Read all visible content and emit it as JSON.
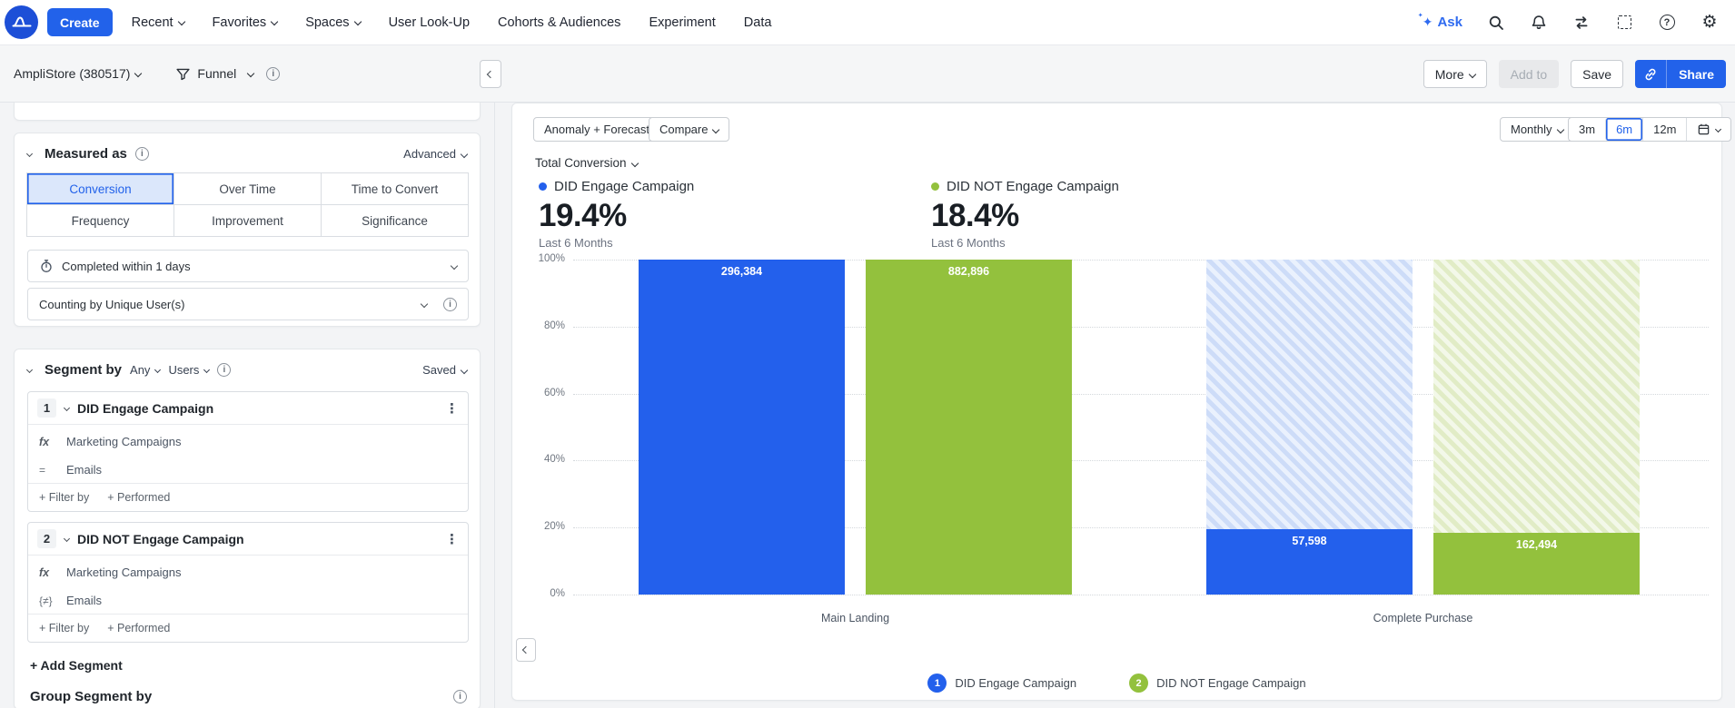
{
  "colors": {
    "accent": "#2262ea",
    "series_blue": "#2360ec",
    "series_green": "#93c13d"
  },
  "nav": {
    "create_label": "Create",
    "items": [
      {
        "label": "Recent",
        "dropdown": true
      },
      {
        "label": "Favorites",
        "dropdown": true
      },
      {
        "label": "Spaces",
        "dropdown": true
      },
      {
        "label": "User Look-Up",
        "dropdown": false
      },
      {
        "label": "Cohorts & Audiences",
        "dropdown": false
      },
      {
        "label": "Experiment",
        "dropdown": false
      },
      {
        "label": "Data",
        "dropdown": false
      }
    ],
    "ask_label": "Ask",
    "icons": [
      "sparkle-icon",
      "search-icon",
      "bell-icon",
      "swap-icon",
      "frame-icon",
      "help-icon",
      "settings-icon"
    ]
  },
  "toolbar": {
    "project": "AmpliStore (380517)",
    "chart_type": "Funnel",
    "more_label": "More",
    "add_to_label": "Add to",
    "save_label": "Save",
    "share_label": "Share"
  },
  "measured_as": {
    "title": "Measured as",
    "advanced_label": "Advanced",
    "tabs": [
      "Conversion",
      "Over Time",
      "Time to Convert",
      "Frequency",
      "Improvement",
      "Significance"
    ],
    "selected_tab": "Conversion",
    "completed_within": "Completed within 1 days",
    "counting_by": "Counting by Unique User(s)"
  },
  "segment_by": {
    "title": "Segment by",
    "any_label": "Any",
    "users_label": "Users",
    "saved_label": "Saved",
    "segments": [
      {
        "index": "1",
        "name": "DID Engage Campaign",
        "property": "Marketing Campaigns",
        "operator": "=",
        "value": "Emails",
        "filter_label": "+ Filter by",
        "performed_label": "+ Performed"
      },
      {
        "index": "2",
        "name": "DID NOT Engage Campaign",
        "property": "Marketing Campaigns",
        "operator": "{≠}",
        "value": "Emails",
        "filter_label": "+ Filter by",
        "performed_label": "+ Performed"
      }
    ],
    "add_segment_label": "+ Add Segment",
    "group_segment_label": "Group Segment by"
  },
  "chart_header": {
    "anomaly_label": "Anomaly + Forecast",
    "compare_label": "Compare",
    "interval_label": "Monthly",
    "ranges": [
      "3m",
      "6m",
      "12m"
    ],
    "selected_range": "6m",
    "metric_label": "Total Conversion"
  },
  "stats": [
    {
      "name": "DID Engage Campaign",
      "value": "19.4%",
      "period": "Last 6 Months",
      "color": "#2360ec"
    },
    {
      "name": "DID NOT Engage Campaign",
      "value": "18.4%",
      "period": "Last 6 Months",
      "color": "#93c13d"
    }
  ],
  "chart_data": {
    "type": "bar",
    "title": "Total Conversion",
    "categories": [
      "Main Landing",
      "Complete Purchase"
    ],
    "series": [
      {
        "name": "DID Engage Campaign",
        "color": "#2360ec",
        "values_pct": [
          100,
          19.4
        ],
        "counts": [
          "296,384",
          "57,598"
        ]
      },
      {
        "name": "DID NOT Engage Campaign",
        "color": "#93c13d",
        "values_pct": [
          100,
          18.4
        ],
        "counts": [
          "882,896",
          "162,494"
        ]
      }
    ],
    "ylabel_ticks": [
      "100%",
      "80%",
      "60%",
      "40%",
      "20%",
      "0%"
    ],
    "ylim": [
      0,
      100
    ],
    "grid": "dotted-horizontal",
    "legend_position": "bottom",
    "legend": [
      {
        "num": "1",
        "label": "DID Engage Campaign",
        "color": "#2360ec"
      },
      {
        "num": "2",
        "label": "DID NOT Engage Campaign",
        "color": "#93c13d"
      }
    ]
  }
}
